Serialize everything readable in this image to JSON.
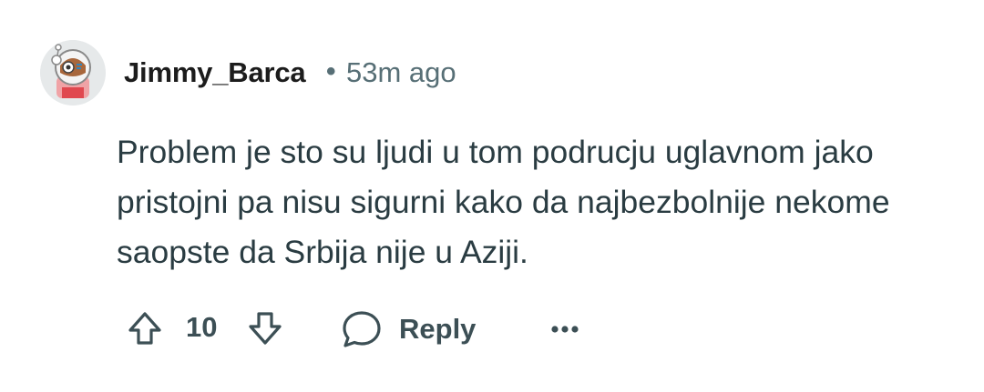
{
  "comment": {
    "author": "Jimmy_Barca",
    "separator": "•",
    "time": "53m ago",
    "text": "Problem je sto su ljudi u tom podrucju uglavnom jako pristojni pa nisu sigurni kako da najbezbolnije nekome saopste da Srbija nije u Aziji.",
    "score": "10",
    "reply_label": "Reply",
    "avatar_icon": "astronaut-avatar",
    "icons": {
      "upvote": "upvote-arrow-icon",
      "downvote": "downvote-arrow-icon",
      "reply": "speech-bubble-icon",
      "more": "ellipsis-icon"
    },
    "colors": {
      "text": "#2a3c42",
      "meta": "#576f76",
      "actions": "#3c4f55"
    }
  }
}
